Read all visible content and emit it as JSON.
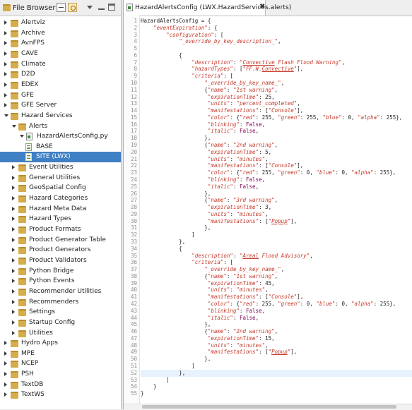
{
  "file_browser": {
    "title": "File Browser",
    "tree": [
      {
        "label": "Alertviz",
        "depth": 0,
        "kind": "folder",
        "expanded": false
      },
      {
        "label": "Archive",
        "depth": 0,
        "kind": "folder",
        "expanded": false
      },
      {
        "label": "AvnFPS",
        "depth": 0,
        "kind": "folder",
        "expanded": false
      },
      {
        "label": "CAVE",
        "depth": 0,
        "kind": "folder",
        "expanded": false
      },
      {
        "label": "Climate",
        "depth": 0,
        "kind": "folder",
        "expanded": false
      },
      {
        "label": "D2D",
        "depth": 0,
        "kind": "folder",
        "expanded": false
      },
      {
        "label": "EDEX",
        "depth": 0,
        "kind": "folder",
        "expanded": false
      },
      {
        "label": "GFE",
        "depth": 0,
        "kind": "folder",
        "expanded": false
      },
      {
        "label": "GFE Server",
        "depth": 0,
        "kind": "folder",
        "expanded": false
      },
      {
        "label": "Hazard Services",
        "depth": 0,
        "kind": "folder",
        "expanded": true
      },
      {
        "label": "Alerts",
        "depth": 1,
        "kind": "folder",
        "expanded": true
      },
      {
        "label": "HazardAlertsConfig.py",
        "depth": 2,
        "kind": "pyfile",
        "expanded": true
      },
      {
        "label": "BASE",
        "depth": 3,
        "kind": "doc"
      },
      {
        "label": "SITE (LWX)",
        "depth": 3,
        "kind": "doc",
        "selected": true
      },
      {
        "label": "Event Utilities",
        "depth": 1,
        "kind": "folder",
        "expanded": false
      },
      {
        "label": "General Utilities",
        "depth": 1,
        "kind": "folder",
        "expanded": false
      },
      {
        "label": "GeoSpatial Config",
        "depth": 1,
        "kind": "folder",
        "expanded": false
      },
      {
        "label": "Hazard Categories",
        "depth": 1,
        "kind": "folder",
        "expanded": false
      },
      {
        "label": "Hazard Meta Data",
        "depth": 1,
        "kind": "folder",
        "expanded": false
      },
      {
        "label": "Hazard Types",
        "depth": 1,
        "kind": "folder",
        "expanded": false
      },
      {
        "label": "Product Formats",
        "depth": 1,
        "kind": "folder",
        "expanded": false
      },
      {
        "label": "Product Generator Table",
        "depth": 1,
        "kind": "folder",
        "expanded": false
      },
      {
        "label": "Product Generators",
        "depth": 1,
        "kind": "folder",
        "expanded": false
      },
      {
        "label": "Product Validators",
        "depth": 1,
        "kind": "folder",
        "expanded": false
      },
      {
        "label": "Python Bridge",
        "depth": 1,
        "kind": "folder",
        "expanded": false
      },
      {
        "label": "Python Events",
        "depth": 1,
        "kind": "folder",
        "expanded": false
      },
      {
        "label": "Recommender Utilities",
        "depth": 1,
        "kind": "folder",
        "expanded": false
      },
      {
        "label": "Recommenders",
        "depth": 1,
        "kind": "folder",
        "expanded": false
      },
      {
        "label": "Settings",
        "depth": 1,
        "kind": "folder",
        "expanded": false
      },
      {
        "label": "Startup Config",
        "depth": 1,
        "kind": "folder",
        "expanded": false
      },
      {
        "label": "Utilities",
        "depth": 1,
        "kind": "folder",
        "expanded": false
      },
      {
        "label": "Hydro Apps",
        "depth": 0,
        "kind": "folder",
        "expanded": false
      },
      {
        "label": "MPE",
        "depth": 0,
        "kind": "folder",
        "expanded": false
      },
      {
        "label": "NCEP",
        "depth": 0,
        "kind": "folder",
        "expanded": false
      },
      {
        "label": "PSH",
        "depth": 0,
        "kind": "folder",
        "expanded": false
      },
      {
        "label": "TextDB",
        "depth": 0,
        "kind": "folder",
        "expanded": false
      },
      {
        "label": "TextWS",
        "depth": 0,
        "kind": "folder",
        "expanded": false
      }
    ]
  },
  "editor": {
    "tab_title": "HazardAlertsConfig (LWX.HazardServices.alerts)",
    "tab_close": "✖",
    "highlighted_line": 52,
    "lines": [
      "HazardAlertsConfig = {",
      "    \"eventExpiration\": {",
      "        \"configuration\": [",
      "            \"_override_by_key_description_\",",
      "",
      "            {",
      "                \"description\": \"Convective Flash Flood Warning\",",
      "                \"hazardTypes\": [\"FF.W.Convective\"],",
      "                \"criteria\": [",
      "                    \"_override_by_key_name_\",",
      "                    {\"name\": \"1st warning\",",
      "                     \"expirationTime\": 25,",
      "                     \"units\": \"percent_completed\",",
      "                     \"manifestations\": [\"Console\"],",
      "                     \"color\": {\"red\": 255, \"green\": 255, \"blue\": 0, \"alpha\": 255},",
      "                     \"blinking\": False,",
      "                     \"italic\": False,",
      "                    },",
      "                    {\"name\": \"2nd warning\",",
      "                     \"expirationTime\": 5,",
      "                     \"units\": \"minutes\",",
      "                     \"manifestations\": [\"Console\"],",
      "                     \"color\": {\"red\": 255, \"green\": 0, \"blue\": 0, \"alpha\": 255},",
      "                     \"blinking\": False,",
      "                     \"italic\": False,",
      "                    },",
      "                    {\"name\": \"3rd warning\",",
      "                     \"expirationTime\": 3,",
      "                     \"units\": \"minutes\",",
      "                     \"manifestations\": [\"Popup\"],",
      "                    },",
      "                ]",
      "            },",
      "            {",
      "                \"description\": \"Areal Flood Advisory\",",
      "                \"criteria\": [",
      "                    \"_override_by_key_name_\",",
      "                    {\"name\": \"1st warning\",",
      "                     \"expirationTime\": 45,",
      "                     \"units\": \"minutes\",",
      "                     \"manifestations\": [\"Console\"],",
      "                     \"color\": {\"red\": 255, \"green\": 0, \"blue\": 0, \"alpha\": 255},",
      "                     \"blinking\": False,",
      "                     \"italic\": False,",
      "                    },",
      "                    {\"name\": \"2nd warning\",",
      "                     \"expirationTime\": 15,",
      "                     \"units\": \"minutes\",",
      "                     \"manifestations\": [\"Popup\"],",
      "                    },",
      "                ]",
      "            },",
      "        ]",
      "    }",
      "}"
    ]
  },
  "colors": {
    "selection": "#3f7fc4",
    "string": "#c63a2b",
    "current_line": "#e8f2fe"
  }
}
